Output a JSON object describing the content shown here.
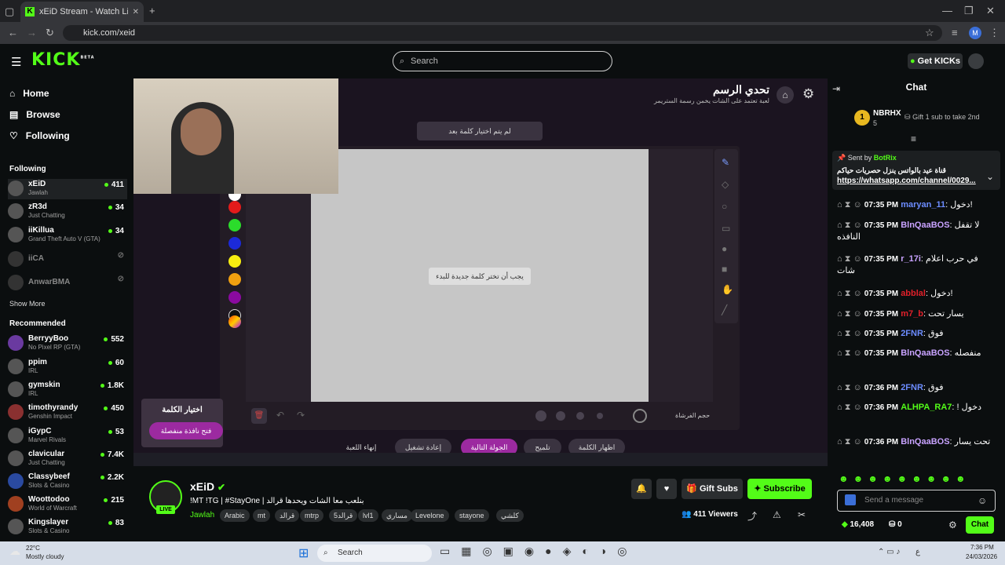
{
  "browser": {
    "tab_title": "xEiD Stream - Watch Live o",
    "url": "kick.com/xeid",
    "profile": "M"
  },
  "header": {
    "logo": "KICK",
    "beta": "BETA",
    "search_placeholder": "Search",
    "get_kicks": "Get KICKs"
  },
  "sidebar": {
    "nav": [
      {
        "label": "Home",
        "icon": "home-icon"
      },
      {
        "label": "Browse",
        "icon": "browse-icon"
      },
      {
        "label": "Following",
        "icon": "heart-icon"
      }
    ],
    "following_title": "Following",
    "following": [
      {
        "name": "xEiD",
        "category": "Jawlah",
        "viewers": "411"
      },
      {
        "name": "zR3d",
        "category": "Just Chatting",
        "viewers": "34"
      },
      {
        "name": "iiKillua",
        "category": "Grand Theft Auto V (GTA)",
        "viewers": "34"
      },
      {
        "name": "iiCA",
        "category": "",
        "viewers": ""
      },
      {
        "name": "AnwarBMA",
        "category": "",
        "viewers": ""
      }
    ],
    "show_more": "Show More",
    "recommended_title": "Recommended",
    "recommended": [
      {
        "name": "BerryyBoo",
        "category": "No Pixel RP (GTA)",
        "viewers": "552"
      },
      {
        "name": "ppim",
        "category": "IRL",
        "viewers": "60"
      },
      {
        "name": "gymskin",
        "category": "IRL",
        "viewers": "1.8K"
      },
      {
        "name": "timothyrandy",
        "category": "Genshin Impact",
        "viewers": "450"
      },
      {
        "name": "iGypC",
        "category": "Marvel Rivals",
        "viewers": "53"
      },
      {
        "name": "clavicular",
        "category": "Just Chatting",
        "viewers": "7.4K"
      },
      {
        "name": "Classybeef",
        "category": "Slots & Casino",
        "viewers": "2.2K"
      },
      {
        "name": "Woottodoo",
        "category": "World of Warcraft",
        "viewers": "215"
      },
      {
        "name": "Kingslayer",
        "category": "Slots & Casino",
        "viewers": "83"
      }
    ]
  },
  "game": {
    "title": "تحدي الرسم",
    "subtitle": "لعبة تعتمد على الشات يخمن رسمة الستريمر",
    "not_chosen": "لم يتم اختيار كلمة بعد",
    "hint": "يجب أن تختر كلمة جديدة للبدء",
    "choose_word": "اختيار الكلمة",
    "open_window": "فتح نافذة منفصلة",
    "brush_size": "حجم الفرشاة",
    "buttons": [
      "إنهاء اللعبة",
      "إعادة تشغيل",
      "الجولة التالية",
      "تلميح",
      "اظهار الكلمة"
    ],
    "colors": [
      "#ffffff",
      "#e31b1b",
      "#2bdc2b",
      "#1c2ad8",
      "#f7ee10",
      "#f0a010",
      "#8a0aa0",
      "#111111"
    ]
  },
  "channel": {
    "name": "xEiD",
    "live": "LIVE",
    "title": "!MT !TG | #StayOne | بنلعب معا الشات ويحدها قرالد",
    "category": "Jawlah",
    "tags": [
      "Arabic",
      "mt",
      "قرالد",
      "mtrp",
      "5قرالد",
      "lvl1",
      "مساري",
      "Levelone",
      "stayone",
      "كلشي"
    ],
    "viewers": "411 Viewers",
    "gift_subs": "Gift Subs",
    "subscribe": "Subscribe"
  },
  "chat": {
    "title": "Chat",
    "top_gifter": {
      "name": "NBRHX",
      "count": "5",
      "rank": "1"
    },
    "gift_cta": "Gift 1 sub to take 2nd",
    "pinned": {
      "sent_by": "Sent by",
      "bot": "BotRix",
      "text": "قناة عيد بالواتس ينزل حصريات حياكم",
      "link": "https://whatsapp.com/channel/0029..."
    },
    "messages": [
      {
        "time": "07:35 PM",
        "user": "maryan_11",
        "color": "#6c8cff",
        "text": "دخول!"
      },
      {
        "time": "07:35 PM",
        "user": "BlnQaaBOS",
        "color": "#c8a2ff",
        "text": "لا تقفل النافذه"
      },
      {
        "time": "07:35 PM",
        "user": "r_17i",
        "color": "#c8a2ff",
        "text": "في حرب اعلام شات"
      },
      {
        "time": "07:35 PM",
        "user": "abblal",
        "color": "#e0202a",
        "text": "دخول!"
      },
      {
        "time": "07:35 PM",
        "user": "m7_b",
        "color": "#e0202a",
        "text": "يسار تحت"
      },
      {
        "time": "07:35 PM",
        "user": "2FNR",
        "color": "#6c8cff",
        "text": "فوق"
      },
      {
        "time": "07:35 PM",
        "user": "BlnQaaBOS",
        "color": "#c8a2ff",
        "text": "منفصله"
      },
      {
        "time": "07:36 PM",
        "user": "2FNR",
        "color": "#6c8cff",
        "text": "فوق"
      },
      {
        "time": "07:36 PM",
        "user": "ALHPA_RA7",
        "color": "#53fc18",
        "text": "! دخول"
      },
      {
        "time": "07:36 PM",
        "user": "BlnQaaBOS",
        "color": "#c8a2ff",
        "text": "تحت يسار"
      }
    ],
    "placeholder": "Send a message",
    "points": "16,408",
    "count2": "0",
    "send": "Chat"
  },
  "taskbar": {
    "weather_temp": "22°C",
    "weather_desc": "Mostly cloudy",
    "search": "Search",
    "lang": "ع",
    "time": "7:36 PM",
    "date": "24/03/2026"
  }
}
